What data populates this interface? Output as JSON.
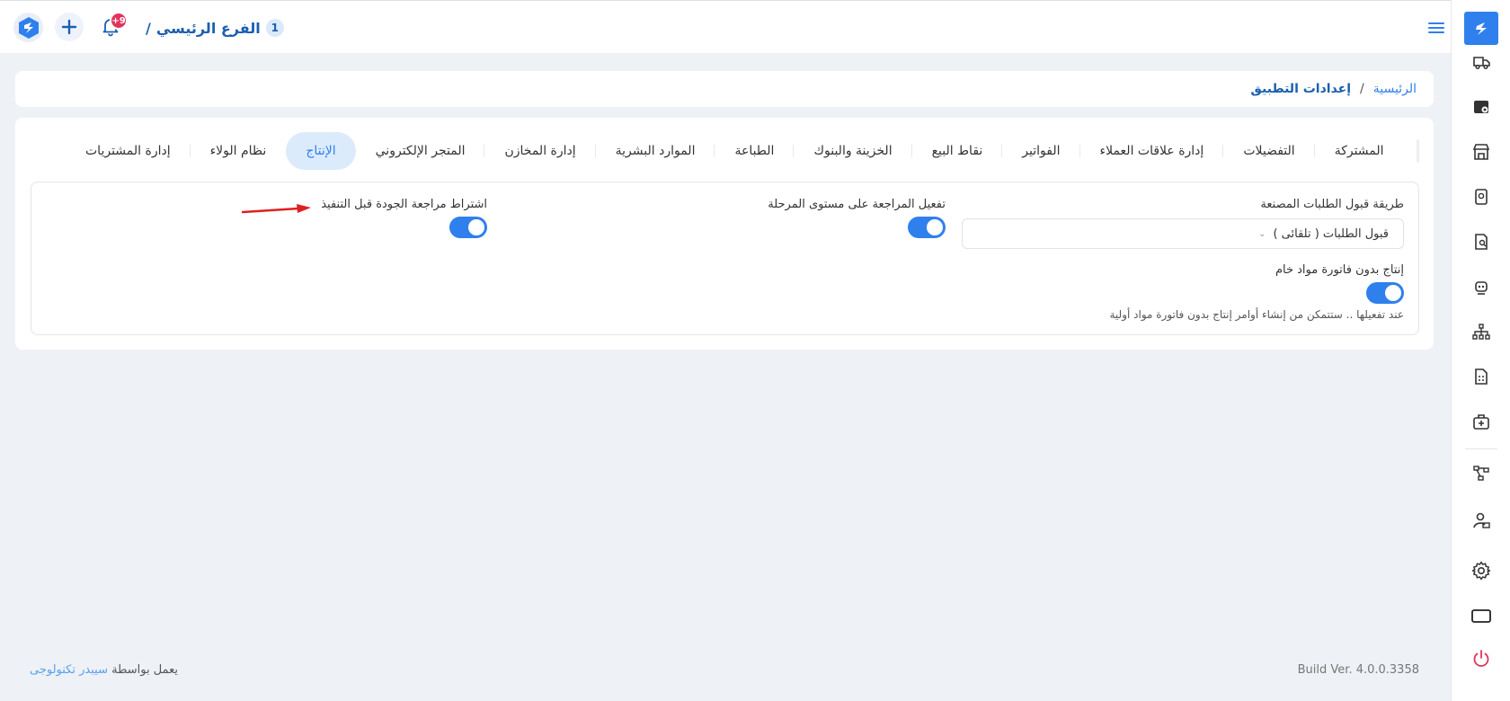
{
  "header": {
    "branch_number": "1",
    "branch_name": "الفرع الرئيسي",
    "separator": "/",
    "notification_badge": "+9"
  },
  "breadcrumb": {
    "home": "الرئيسية",
    "separator": "/",
    "current": "إعدادات التطبيق"
  },
  "tabs": [
    {
      "label": "المشتركة",
      "active": false
    },
    {
      "label": "التفضيلات",
      "active": false
    },
    {
      "label": "إدارة علاقات العملاء",
      "active": false
    },
    {
      "label": "الفواتير",
      "active": false
    },
    {
      "label": "نقاط البيع",
      "active": false
    },
    {
      "label": "الخزينة والبنوك",
      "active": false
    },
    {
      "label": "الطباعة",
      "active": false
    },
    {
      "label": "الموارد البشرية",
      "active": false
    },
    {
      "label": "إدارة المخازن",
      "active": false
    },
    {
      "label": "المتجر الإلكتروني",
      "active": false
    },
    {
      "label": "الإنتاج",
      "active": true
    },
    {
      "label": "نظام الولاء",
      "active": false
    },
    {
      "label": "إدارة المشتريات",
      "active": false
    }
  ],
  "settings": {
    "order_acceptance_label": "طريقة قبول الطلبات المصنعة",
    "order_acceptance_value": "قبول الطلبات ( تلقائى )",
    "stage_review_label": "تفعيل المراجعة على مستوى المرحلة",
    "stage_review_on": true,
    "quality_review_label": "اشتراط مراجعة الجودة قبل التنفيذ",
    "quality_review_on": true,
    "no_bom_label": "إنتاج بدون فاتورة مواد خام",
    "no_bom_on": true,
    "no_bom_hint": "عند تفعيلها .. ستتمكن من إنشاء أوامر إنتاج بدون فاتورة مواد أولية"
  },
  "footer": {
    "powered_prefix": "يعمل بواسطة",
    "powered_brand": "سيبدر تكنولوجى",
    "build": "Build Ver. 4.0.0.3358"
  },
  "icons": {
    "sidebar": [
      "truck-icon",
      "store-settings-icon",
      "shop-icon",
      "document-icon",
      "report-search-icon",
      "robot-icon",
      "hierarchy-icon",
      "invoice-icon",
      "medical-bag-icon",
      "workflow-icon",
      "user-card-icon",
      "gear-icon",
      "monitor-icon",
      "power-icon"
    ]
  },
  "colors": {
    "accent": "#2f80ed",
    "brand_dark": "#1b5fae",
    "badge": "#e0345c",
    "active_tab_bg": "#dcebfb",
    "power": "#e0345c"
  }
}
